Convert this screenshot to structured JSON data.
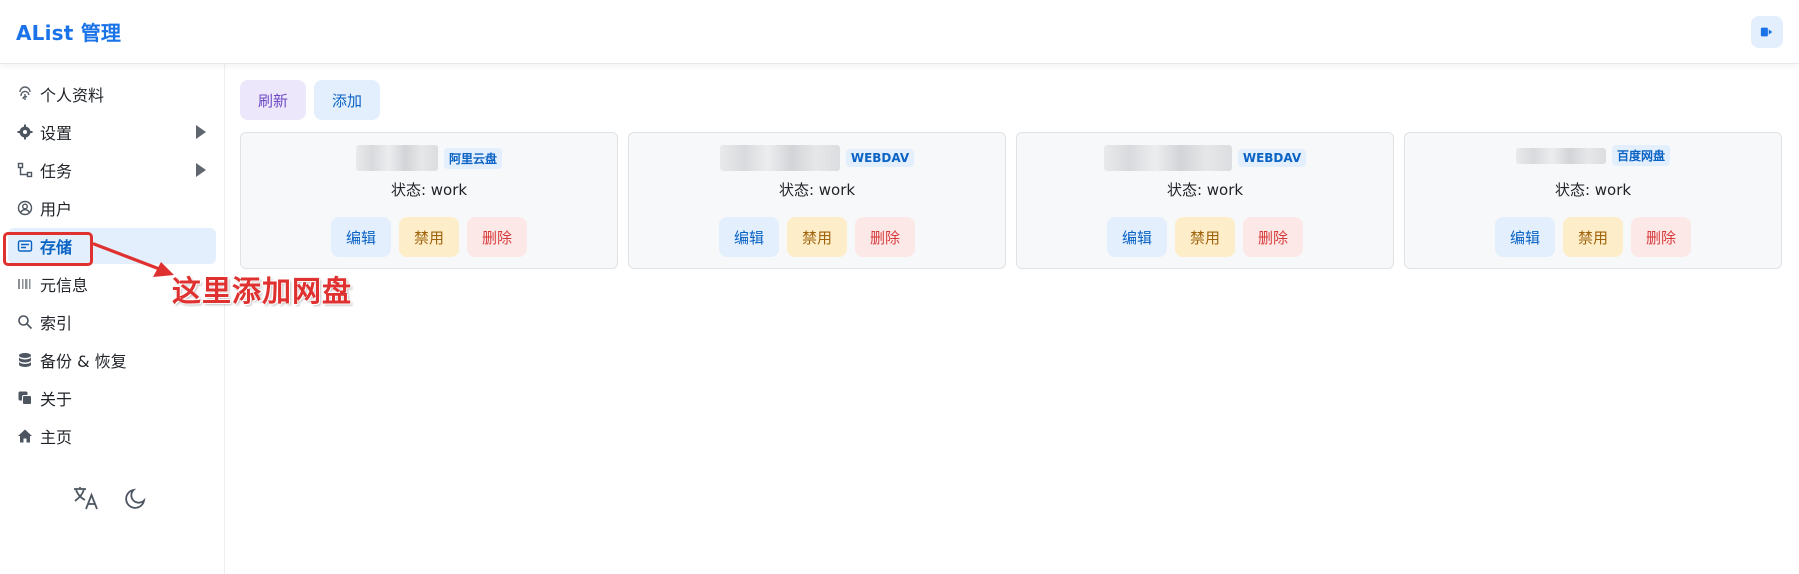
{
  "header": {
    "title": "AList 管理",
    "logout_icon": "logout-icon"
  },
  "sidebar": {
    "items": [
      {
        "label": "个人资料",
        "icon": "fingerprint-icon",
        "has_submenu": false
      },
      {
        "label": "设置",
        "icon": "gear-icon",
        "has_submenu": true
      },
      {
        "label": "任务",
        "icon": "tasks-icon",
        "has_submenu": true
      },
      {
        "label": "用户",
        "icon": "user-icon",
        "has_submenu": false
      },
      {
        "label": "存储",
        "icon": "storage-icon",
        "has_submenu": false,
        "active": true
      },
      {
        "label": "元信息",
        "icon": "meta-icon",
        "has_submenu": false
      },
      {
        "label": "索引",
        "icon": "search-icon",
        "has_submenu": false
      },
      {
        "label": "备份 & 恢复",
        "icon": "database-icon",
        "has_submenu": false
      },
      {
        "label": "关于",
        "icon": "copy-icon",
        "has_submenu": false
      },
      {
        "label": "主页",
        "icon": "home-icon",
        "has_submenu": false
      }
    ],
    "tools": [
      "translate-icon",
      "moon-icon"
    ]
  },
  "annotation": {
    "text": "这里添加网盘",
    "color": "#e03131"
  },
  "toolbar": {
    "refresh_label": "刷新",
    "add_label": "添加"
  },
  "storages": [
    {
      "driver": "阿里云盘",
      "status": "状态: work",
      "edit": "编辑",
      "disable": "禁用",
      "delete": "删除"
    },
    {
      "driver": "WEBDAV",
      "status": "状态: work",
      "edit": "编辑",
      "disable": "禁用",
      "delete": "删除"
    },
    {
      "driver": "WEBDAV",
      "status": "状态: work",
      "edit": "编辑",
      "disable": "禁用",
      "delete": "删除"
    },
    {
      "driver": "百度网盘",
      "status": "状态: work",
      "edit": "编辑",
      "disable": "禁用",
      "delete": "删除"
    }
  ],
  "colors": {
    "accent": "#1a73e8",
    "active_bg": "#e3effd",
    "refresh_bg": "#ede7fb",
    "disable_bg": "#fdedc8",
    "delete_bg": "#fde8e8"
  }
}
